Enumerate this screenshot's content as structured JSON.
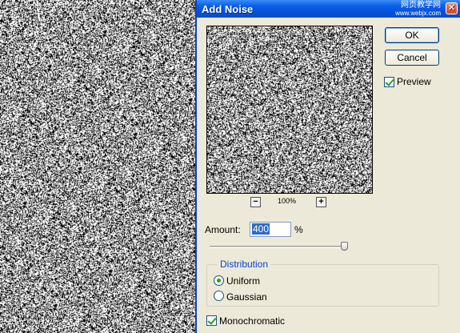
{
  "dialog": {
    "title": "Add Noise",
    "watermark_text": "网页教学网",
    "watermark_site": "www.webjx.com",
    "close_label": "✕",
    "ok_label": "OK",
    "cancel_label": "Cancel",
    "preview_label": "Preview",
    "preview_checked": true,
    "zoom": {
      "minus_label": "−",
      "level": "100%",
      "plus_label": "+"
    },
    "amount": {
      "label": "Amount:",
      "value": "400",
      "unit": "%",
      "slider_fraction": 0.98
    },
    "distribution": {
      "legend": "Distribution",
      "options": [
        "Uniform",
        "Gaussian"
      ],
      "selected": "Uniform"
    },
    "monochromatic_label": "Monochromatic",
    "monochromatic_checked": true
  },
  "colors": {
    "titlebar": "#0a5de8",
    "dialog_bg": "#ece9d8",
    "accent_check": "#21a121",
    "legend_text": "#0046d5"
  }
}
